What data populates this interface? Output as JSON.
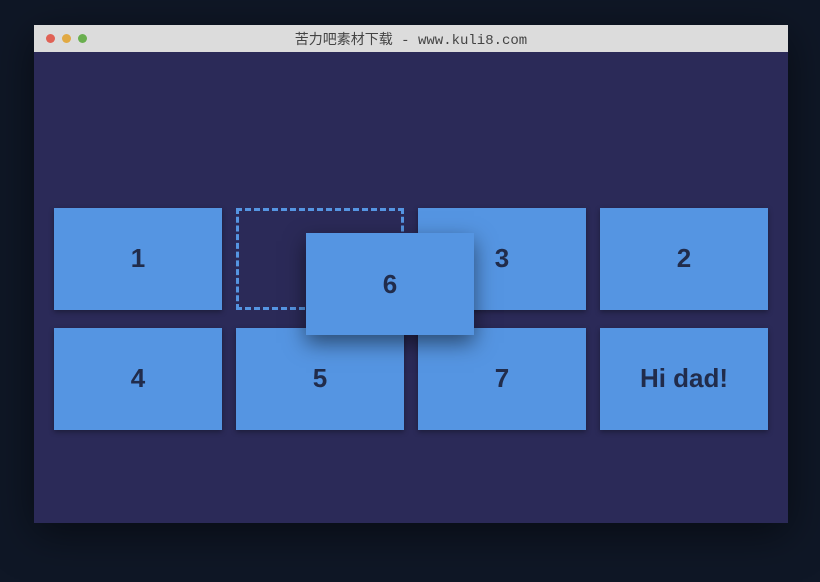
{
  "window": {
    "title": "苦力吧素材下载 - www.kuli8.com"
  },
  "grid": {
    "cards": [
      {
        "label": "1",
        "placeholder": false
      },
      {
        "label": "",
        "placeholder": true
      },
      {
        "label": "3",
        "placeholder": false
      },
      {
        "label": "2",
        "placeholder": false
      },
      {
        "label": "4",
        "placeholder": false
      },
      {
        "label": "5",
        "placeholder": false
      },
      {
        "label": "7",
        "placeholder": false
      },
      {
        "label": "Hi dad!",
        "placeholder": false
      }
    ],
    "dragging": {
      "label": "6"
    }
  },
  "colors": {
    "page_bg": "#0f1726",
    "window_bg": "#2b2a58",
    "card_bg": "#5595e2",
    "card_text": "#212c4b"
  }
}
